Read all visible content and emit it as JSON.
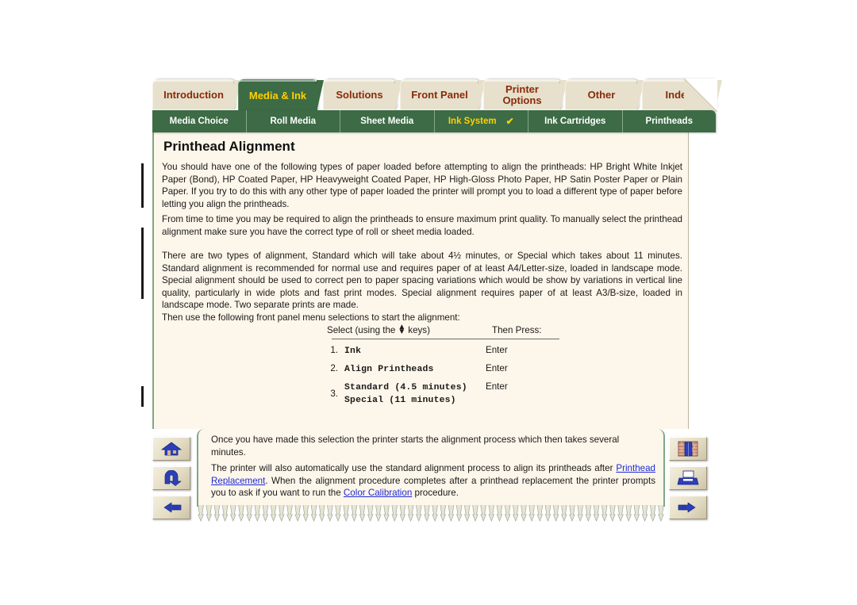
{
  "document": {
    "title": "Printhead Alignment"
  },
  "tabs": [
    {
      "label": "Introduction",
      "active": false
    },
    {
      "label": "Media & Ink",
      "active": true
    },
    {
      "label": "Solutions",
      "active": false
    },
    {
      "label": "Front Panel",
      "active": false
    },
    {
      "label": "Printer Options",
      "line1": "Printer",
      "line2": "Options",
      "active": false
    },
    {
      "label": "Other",
      "active": false
    },
    {
      "label": "Index",
      "active": false
    }
  ],
  "subnav": {
    "items": [
      {
        "label": "Media Choice",
        "active": false,
        "check": ""
      },
      {
        "label": "Roll Media",
        "active": false,
        "check": ""
      },
      {
        "label": "Sheet Media",
        "active": false,
        "check": ""
      },
      {
        "label": "Ink System",
        "active": true,
        "check": "✔"
      },
      {
        "label": "Ink Cartridges",
        "active": false,
        "check": ""
      },
      {
        "label": "Printheads",
        "active": false,
        "check": ""
      }
    ]
  },
  "body": {
    "para1": "You should have one of the following types of paper loaded before attempting to align the printheads: HP Bright White Inkjet Paper (Bond), HP Coated Paper, HP Heavyweight Coated Paper, HP High-Gloss Photo Paper, HP Satin Poster Paper or Plain Paper. If you try to do this with any other type of paper loaded the printer will prompt you to load a different type of paper before letting you align the printheads.",
    "para2": "From time to time you may be required to align the printheads to ensure maximum print quality. To manually select the printhead alignment make sure you have the correct type of roll or sheet media loaded.",
    "para3": "There are two types of alignment, Standard which will take about 4½ minutes, or Special which takes about 11 minutes. Standard alignment is recommended for normal use and requires paper of at least A4/Letter-size, loaded in landscape mode. Special alignment should be used to correct pen to paper spacing variations which would be show by variations in vertical line quality, particularly in wide plots and fast print modes. Special alignment requires paper of at least A3/B-size, loaded in landscape mode. Two separate prints are made.",
    "para4": "Then use the following front panel menu selections to start the alignment:",
    "para5": "Once you have made this selection the printer starts the alignment process which then takes several minutes.",
    "para6_a": "The printer will also automatically use the standard alignment process to align its printheads after ",
    "para6_link1": "Printhead Replacement",
    "para6_b": ". When the alignment procedure completes after a printhead replacement the printer prompts you to ask if you want to run the ",
    "para6_link2": "Color Calibration",
    "para6_c": " procedure."
  },
  "menu_table": {
    "header_select_prefix": "Select (using the",
    "header_select_suffix": "keys)",
    "header_press": "Then Press:",
    "rows": [
      {
        "num": "1.",
        "command": "Ink",
        "command2": "",
        "press": "Enter"
      },
      {
        "num": "2.",
        "command": "Align Printheads",
        "command2": "",
        "press": "Enter"
      },
      {
        "num": "3.",
        "command": "Standard (4.5 minutes)",
        "command2": "Special (11 minutes)",
        "press": "Enter"
      }
    ]
  },
  "nav_buttons": {
    "left": [
      {
        "name": "home-button",
        "icon": "house-icon",
        "label": "Home"
      },
      {
        "name": "back-button",
        "icon": "back-arrow-icon",
        "label": "Back"
      },
      {
        "name": "previous-page-button",
        "icon": "hand-left-icon",
        "label": "Previous page"
      }
    ],
    "right": [
      {
        "name": "bookshelf-button",
        "icon": "bookshelf-icon",
        "label": "Library"
      },
      {
        "name": "print-button",
        "icon": "printer-icon",
        "label": "Print"
      },
      {
        "name": "next-page-button",
        "icon": "hand-right-icon",
        "label": "Next page"
      }
    ]
  },
  "colors": {
    "green": "#3c6b45",
    "tab_beige": "#e6e0cd",
    "tab_text": "#8a2a08",
    "active_tab_text": "#ffd100",
    "page_cream": "#fdf6ea",
    "link_blue": "#1e2ad6",
    "page_border_green": "#7fa784"
  }
}
